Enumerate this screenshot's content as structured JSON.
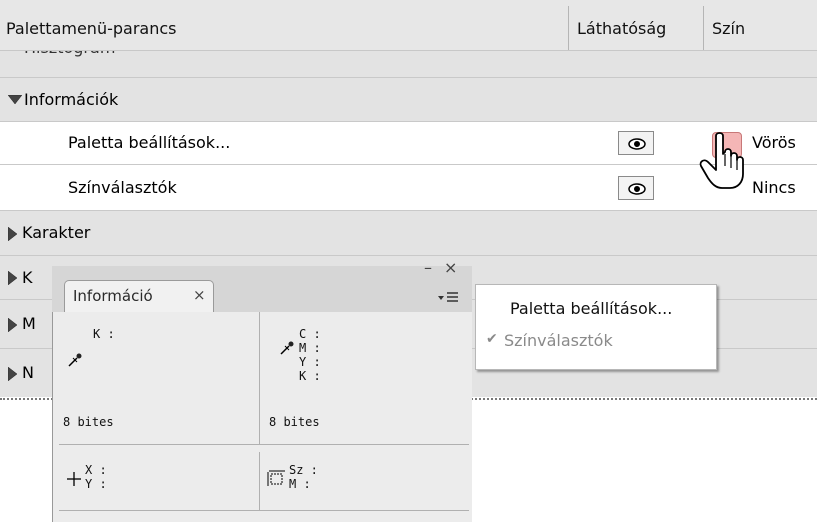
{
  "header": {
    "col_command": "Palettamenü-parancs",
    "col_visibility": "Láthatóság",
    "col_color": "Szín"
  },
  "groups": [
    {
      "label": "Hisztogram",
      "state": "collapsed"
    },
    {
      "label": "Információk",
      "state": "expanded"
    },
    {
      "label": "Karakter",
      "state": "collapsed"
    },
    {
      "label": "K",
      "state": "collapsed"
    },
    {
      "label": "M",
      "state": "collapsed"
    },
    {
      "label": "N",
      "state": "collapsed"
    }
  ],
  "items": [
    {
      "label": "Paletta beállítások...",
      "visible": true,
      "color_label": "Vörös",
      "color_swatch": "#f4b6b6"
    },
    {
      "label": "Színválasztók",
      "visible": true,
      "color_label": "Nincs"
    }
  ],
  "panel": {
    "tab_label": "Információ",
    "tab_close": "×",
    "window_minimize": "–",
    "window_close": "×",
    "left_label": "K :",
    "right_labels": [
      "C :",
      "M :",
      "Y :",
      "K :"
    ],
    "bits_left": "8 bites",
    "bits_right": "8 bites",
    "xy_labels": [
      "X :",
      "Y :"
    ],
    "size_labels": [
      "Sz :",
      "M :"
    ]
  },
  "flyout": {
    "items": [
      {
        "label": "Paletta beállítások...",
        "checked": false
      },
      {
        "label": "Színválasztók",
        "checked": true
      }
    ],
    "check_mark": "✔"
  },
  "colors": {
    "header_bg": "#e7e7e7",
    "group_bg": "#e3e3e3",
    "swatch_red": "#f4b6b6"
  }
}
